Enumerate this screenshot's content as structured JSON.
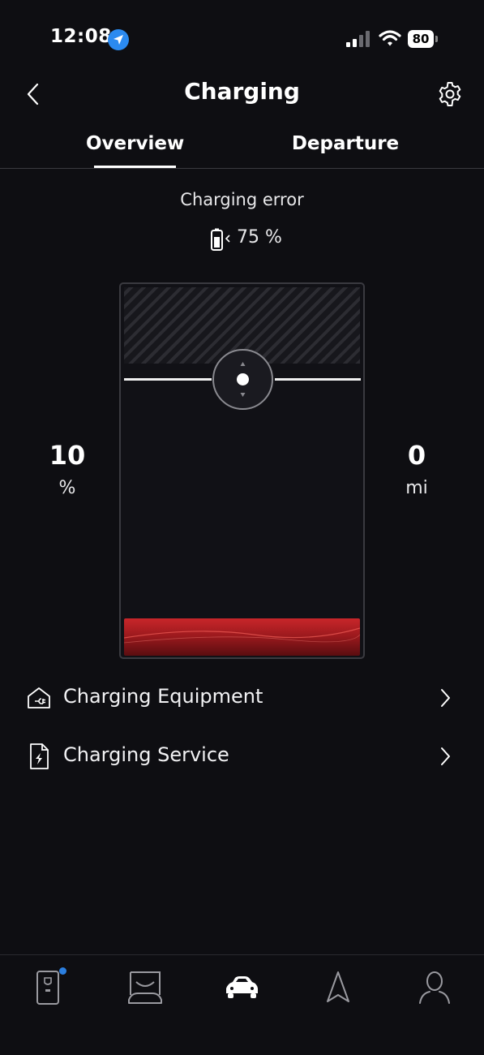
{
  "status_bar": {
    "time": "12:08",
    "battery": "80"
  },
  "header": {
    "title": "Charging",
    "icons": {
      "back": "chevron-left-icon",
      "settings": "gear-icon"
    }
  },
  "tabs": [
    {
      "label": "Overview",
      "active": true
    },
    {
      "label": "Departure",
      "active": false
    }
  ],
  "charging": {
    "status": "Charging error",
    "battery_level": "75 %",
    "target_value": "10",
    "target_unit": "%",
    "range_value": "0",
    "range_unit": "mi"
  },
  "menu": [
    {
      "label": "Charging Equipment",
      "icon": "house-plug-icon"
    },
    {
      "label": "Charging Service",
      "icon": "document-bolt-icon"
    }
  ],
  "bottom_nav": [
    {
      "name": "key",
      "icon": "car-key-icon",
      "has_notification": true
    },
    {
      "name": "home",
      "icon": "garage-icon"
    },
    {
      "name": "car",
      "icon": "car-icon",
      "active": true
    },
    {
      "name": "navigate",
      "icon": "navigation-arrow-icon"
    },
    {
      "name": "profile",
      "icon": "person-icon"
    }
  ],
  "colors": {
    "background": "#0e0e12",
    "accent_red": "#c8262a",
    "notification": "#2b7fe0"
  }
}
